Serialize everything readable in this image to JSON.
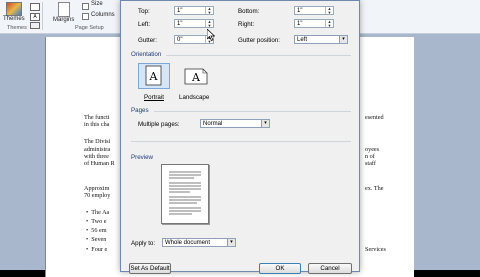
{
  "ribbon": {
    "themes_label": "Themes",
    "size_label": "Size",
    "columns_label": "Columns",
    "margins_label": "Margins",
    "page_setup_label": "Page Setup"
  },
  "document": {
    "lines": [
      "The functi",
      "in this cha",
      "The Divisi",
      "administra",
      "with three",
      "of Human R",
      "Approxim",
      "70 employ",
      "The Aa",
      "Two e",
      "56 em",
      "Seven",
      "Four e"
    ],
    "right_lines": [
      "esented",
      "oyees",
      "n of",
      "staff",
      "ex. The",
      "Services"
    ]
  },
  "dialog": {
    "margins": {
      "top_label": "Top:",
      "top_value": "1\"",
      "bottom_label": "Bottom:",
      "bottom_value": "1\"",
      "left_label": "Left:",
      "left_value": "1\"",
      "right_label": "Right:",
      "right_value": "1\"",
      "gutter_label": "Gutter:",
      "gutter_value": "0\"",
      "gutter_position_label": "Gutter position:",
      "gutter_position_value": "Left"
    },
    "orientation": {
      "section_label": "Orientation",
      "portrait_label": "Portrait",
      "landscape_label": "Landscape",
      "selected": "Portrait"
    },
    "pages": {
      "section_label": "Pages",
      "multiple_pages_label": "Multiple pages:",
      "multiple_pages_value": "Normal"
    },
    "preview": {
      "section_label": "Preview",
      "apply_to_label": "Apply to:",
      "apply_to_value": "Whole document"
    },
    "buttons": {
      "set_default": "Set As Default",
      "ok": "OK",
      "cancel": "Cancel"
    }
  }
}
